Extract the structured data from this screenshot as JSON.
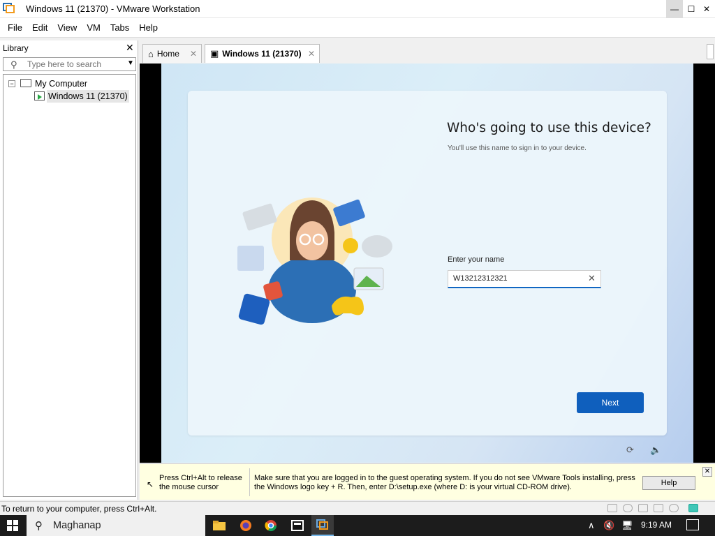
{
  "window": {
    "title": "Windows 11 (21370) - VMware Workstation",
    "min_glyph": "—",
    "max_glyph": "☐",
    "close_glyph": "✕"
  },
  "menu": [
    "File",
    "Edit",
    "View",
    "VM",
    "Tabs",
    "Help"
  ],
  "library": {
    "header": "Library",
    "close_glyph": "✕",
    "search_placeholder": "Type here to search",
    "tree": {
      "expander": "−",
      "root_label": "My Computer",
      "vm_label": "Windows 11 (21370)"
    }
  },
  "tabs": [
    {
      "label": "Home",
      "icon": "home-icon"
    },
    {
      "label": "Windows 11 (21370)",
      "icon": "vm-icon"
    }
  ],
  "oobe": {
    "title": "Who's going to use this device?",
    "subtitle": "You'll use this name to sign in to your device.",
    "name_label": "Enter your name",
    "name_value": "W13212312321",
    "clear_glyph": "✕",
    "next_label": "Next"
  },
  "hint": {
    "left": "Press Ctrl+Alt to release the mouse cursor",
    "right": "Make sure that you are logged in to the guest operating system. If you do not see VMware Tools installing, press the Windows logo key + R. Then, enter D:\\setup.exe (where D: is your virtual CD-ROM drive).",
    "help_label": "Help",
    "close_glyph": "✕"
  },
  "status": {
    "text": "To return to your computer, press Ctrl+Alt."
  },
  "taskbar": {
    "search_text": "Maghanap",
    "clock": "9:19 AM",
    "apps": [
      "file-explorer-icon",
      "firefox-icon",
      "chrome-icon",
      "7zip-icon",
      "vmware-icon"
    ]
  },
  "colors": {
    "accent": "#0f5fbd",
    "hint_bg": "#ffffe1",
    "taskbar": "#1c1c1c"
  }
}
